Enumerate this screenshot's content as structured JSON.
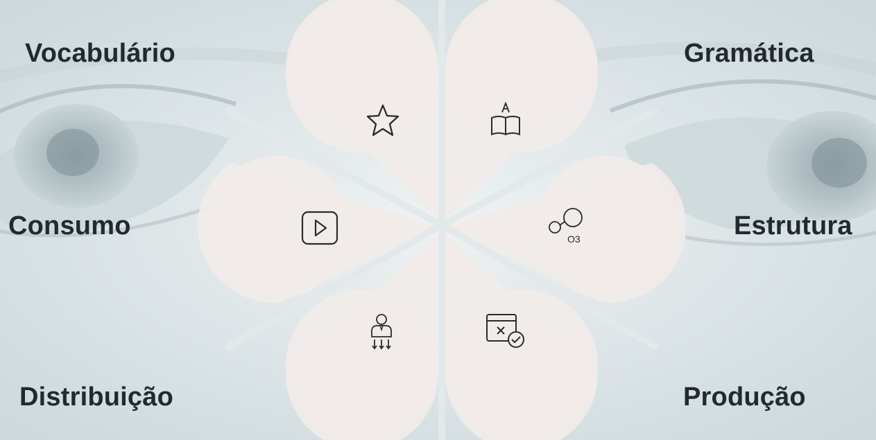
{
  "labels": {
    "vocabulario": "Vocabulário",
    "gramatica": "Gramática",
    "consumo": "Consumo",
    "estrutura": "Estrutura",
    "distribuicao": "Distribuição",
    "producao": "Produção"
  },
  "icons": {
    "vocabulario": "star-icon",
    "gramatica": "book-letter-icon",
    "consumo": "play-icon",
    "estrutura": "ozone-molecule-icon",
    "distribuicao": "person-download-icon",
    "producao": "window-check-icon"
  },
  "molecule_text": "O3",
  "colors": {
    "petal": "#f1ebe9",
    "text": "#222a2e",
    "icon_stroke": "#2a2a2a",
    "background": "#dfe6e8"
  }
}
